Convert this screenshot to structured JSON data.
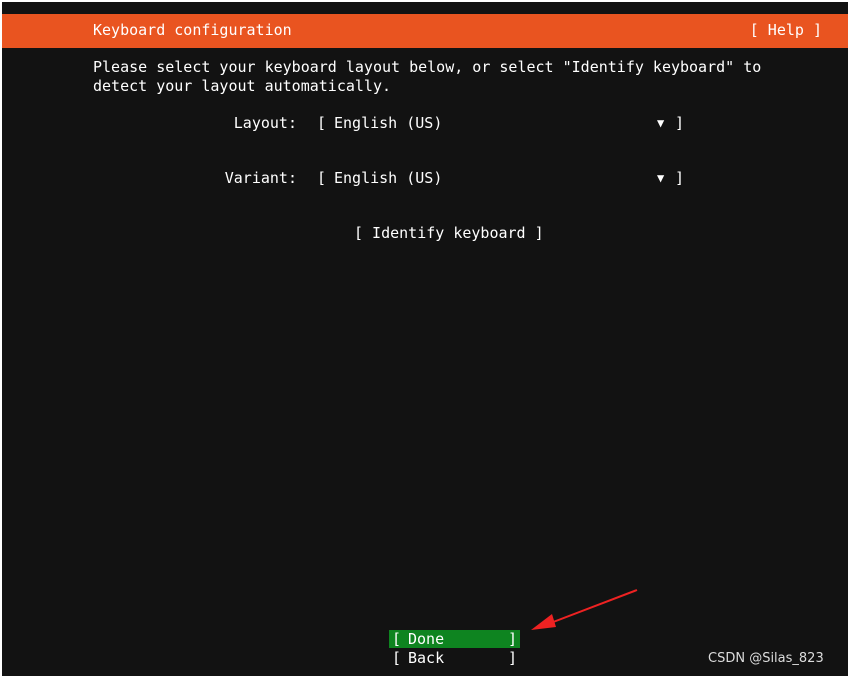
{
  "header": {
    "title": "Keyboard configuration",
    "help_label": "[ Help ]"
  },
  "instructions": "Please select your keyboard layout below, or select \"Identify keyboard\" to\ndetect your layout automatically.",
  "fields": {
    "layout": {
      "label": "Layout:",
      "value": "English (US)"
    },
    "variant": {
      "label": "Variant:",
      "value": "English (US)"
    }
  },
  "identify_label": "[ Identify keyboard ]",
  "buttons": {
    "done_label": "Done",
    "back_label": "Back"
  },
  "watermark": "CSDN @Silas_823",
  "colors": {
    "header": "#e95420",
    "background": "#121212",
    "done_highlight": "#0e8420",
    "annotation_arrow": "#ee2222"
  },
  "icons": {
    "dropdown": "triangle-down-icon"
  }
}
